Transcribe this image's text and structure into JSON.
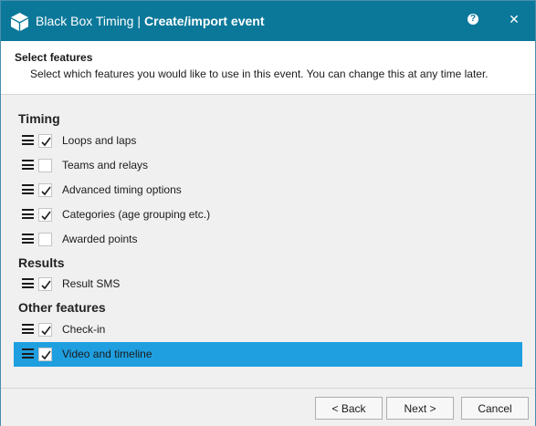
{
  "window": {
    "app_name": "Black Box Timing",
    "separator": "|",
    "dialog_title": "Create/import event",
    "help_glyph": "?",
    "close_glyph": "✕"
  },
  "header": {
    "title": "Select features",
    "subtitle": "Select which features you would like to use in this event. You can change this at any time later."
  },
  "sections": [
    {
      "title": "Timing",
      "items": [
        {
          "label": "Loops and laps",
          "checked": true
        },
        {
          "label": "Teams and relays",
          "checked": false
        },
        {
          "label": "Advanced timing options",
          "checked": true
        },
        {
          "label": "Categories (age grouping etc.)",
          "checked": true
        },
        {
          "label": "Awarded points",
          "checked": false
        }
      ]
    },
    {
      "title": "Results",
      "items": [
        {
          "label": "Result SMS",
          "checked": true
        }
      ]
    },
    {
      "title": "Other features",
      "items": [
        {
          "label": "Check-in",
          "checked": true
        },
        {
          "label": "Video and timeline",
          "checked": true,
          "selected": true
        }
      ]
    }
  ],
  "footer": {
    "back_label": "< Back",
    "next_label": "Next >",
    "cancel_label": "Cancel"
  },
  "colors": {
    "titlebar": "#0b7899",
    "selection": "#1f9fe0"
  }
}
